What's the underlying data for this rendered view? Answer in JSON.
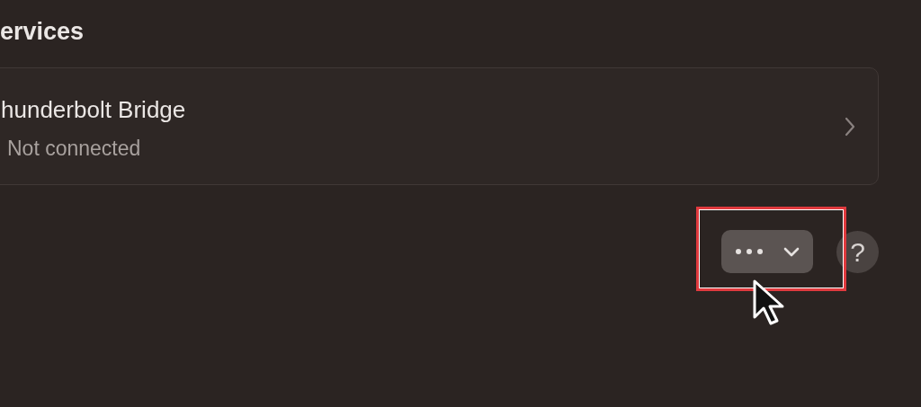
{
  "section": {
    "title": "ervices"
  },
  "services": [
    {
      "name": "hunderbolt Bridge",
      "status": "Not connected"
    }
  ],
  "actions_menu": {
    "highlighted": true,
    "hovered": true
  },
  "help_button": {
    "label": "?"
  }
}
